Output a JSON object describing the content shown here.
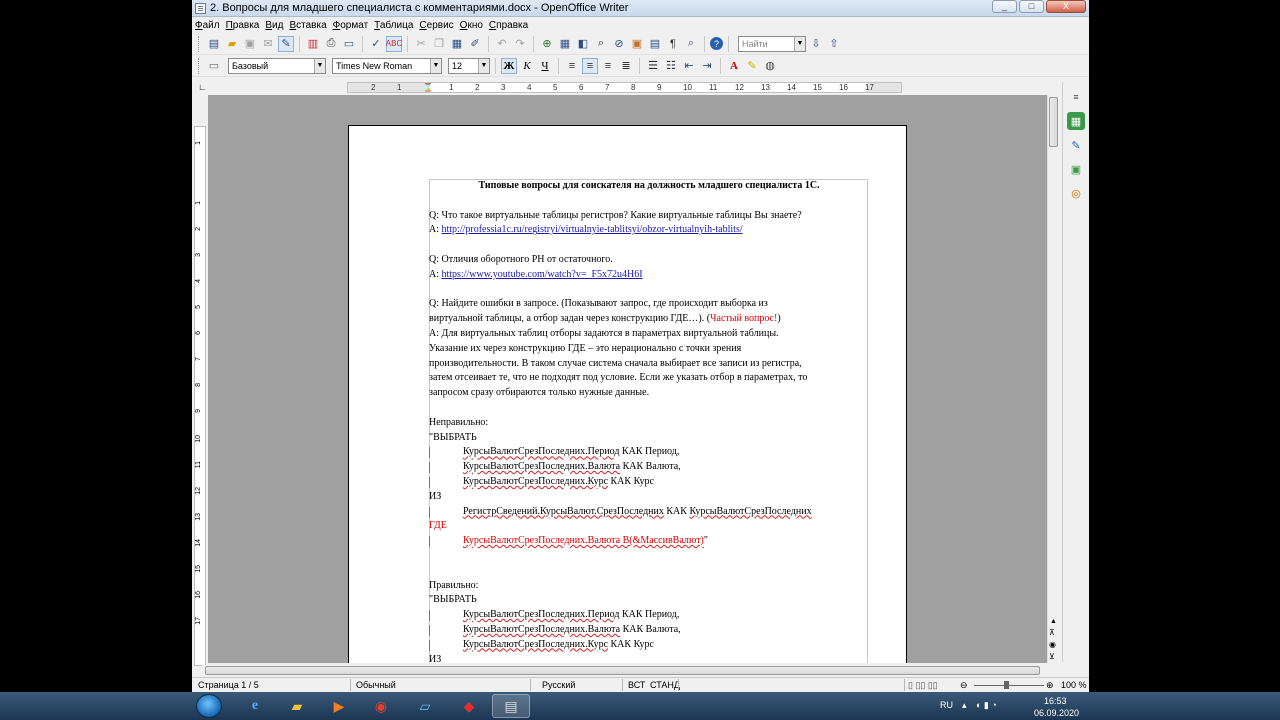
{
  "window": {
    "title": "2. Вопросы для младшего специалиста с комментариями.docx - OpenOffice Writer",
    "minimize": "_",
    "maximize": "□",
    "close": "X"
  },
  "menu": [
    "Файл",
    "Правка",
    "Вид",
    "Вставка",
    "Формат",
    "Таблица",
    "Сервис",
    "Окно",
    "Справка"
  ],
  "toolbar": {
    "find_placeholder": "Найти"
  },
  "format": {
    "style": "Базовый",
    "font": "Times New Roman",
    "size": "12",
    "bold": "Ж",
    "italic": "К",
    "underline": "Ч"
  },
  "ruler": {
    "h_ticks": [
      "2",
      "1",
      "1",
      "2",
      "3",
      "4",
      "5",
      "6",
      "7",
      "8",
      "9",
      "10",
      "11",
      "12",
      "13",
      "14",
      "15",
      "16",
      "17"
    ],
    "v_ticks": [
      "1",
      "1",
      "2",
      "3",
      "4",
      "5",
      "6",
      "7",
      "8",
      "9",
      "10",
      "11",
      "12",
      "13",
      "14",
      "15",
      "16",
      "17"
    ]
  },
  "document": {
    "title": "Типовые вопросы для соискателя на должность младшего специалиста 1С.",
    "q1": "Q: Что такое виртуальные таблицы регистров? Какие виртуальные таблицы Вы знаете?",
    "a1_prefix": "A: ",
    "a1_link": "http://professia1c.ru/registryi/virtualnyie-tablitsyi/obzor-virtualnyih-tablits/",
    "q2": "Q: Отличия оборотного РН от остаточного.",
    "a2_prefix": "A: ",
    "a2_link": "https://www.youtube.com/watch?v=_F5x72u4H6I",
    "q3_line1": "Q: Найдите ошибки в запросе. (Показывают запрос, где происходит выборка из",
    "q3_line2": "виртуальной таблицы, а отбор задан через конструкцию ГДЕ…). (",
    "q3_red": "Частый вопрос!",
    "q3_end": ")",
    "a3_line1": "A: Для виртуальных таблиц отборы задаются в параметрах виртуальной таблицы.",
    "a3_line2": "Указание их через конструкцию ГДЕ – это нерационально с точки зрения",
    "a3_line3": "производительности. В таком случае система сначала выбирает все записи из регистра,",
    "a3_line4": "затем отсеивает те, что не подходят под условие. Если же указать отбор в параметрах, то",
    "a3_line5": "запросом сразу отбираются только нужные данные.",
    "wrong_label": "Неправильно:",
    "select_kw": "\"ВЫБРАТЬ",
    "w_line1_a": "КурсыВалютСрезПоследних.Период",
    "w_line1_b": " КАК Период,",
    "w_line2_a": "КурсыВалютСрезПоследних.Валюта",
    "w_line2_b": " КАК Валюта,",
    "w_line3_a": "КурсыВалютСрезПоследних.Курс",
    "w_line3_b": " КАК Курс",
    "from_kw": "ИЗ",
    "w_from_a": "РегистрСведений.КурсыВалют.СрезПоследних",
    "w_from_b": " КАК ",
    "w_from_c": "КурсыВалютСрезПоследних",
    "where_kw": "ГДЕ",
    "w_where": "КурсыВалютСрезПоследних.Валюта В(&МассивВалют)",
    "w_where_end": "\"",
    "right_label": "Правильно:",
    "r_select_kw": "\"ВЫБРАТЬ",
    "r_line1_a": "КурсыВалютСрезПоследних.Период",
    "r_line1_b": " КАК Период,",
    "r_line2_a": "КурсыВалютСрезПоследних.Валюта",
    "r_line2_b": " КАК Валюта,",
    "r_line3_a": "КурсыВалютСрезПоследних.Курс",
    "r_line3_b": " КАК Курс",
    "r_from_kw": "ИЗ"
  },
  "statusbar": {
    "page": "Страница 1 / 5",
    "style": "Обычный",
    "language": "Русский",
    "insert_mode": "ВСТ",
    "selection_mode": "СТАНД",
    "zoom": "100 %"
  },
  "taskbar": {
    "lang": "RU",
    "time": "16:53",
    "date": "06.09.2020"
  }
}
